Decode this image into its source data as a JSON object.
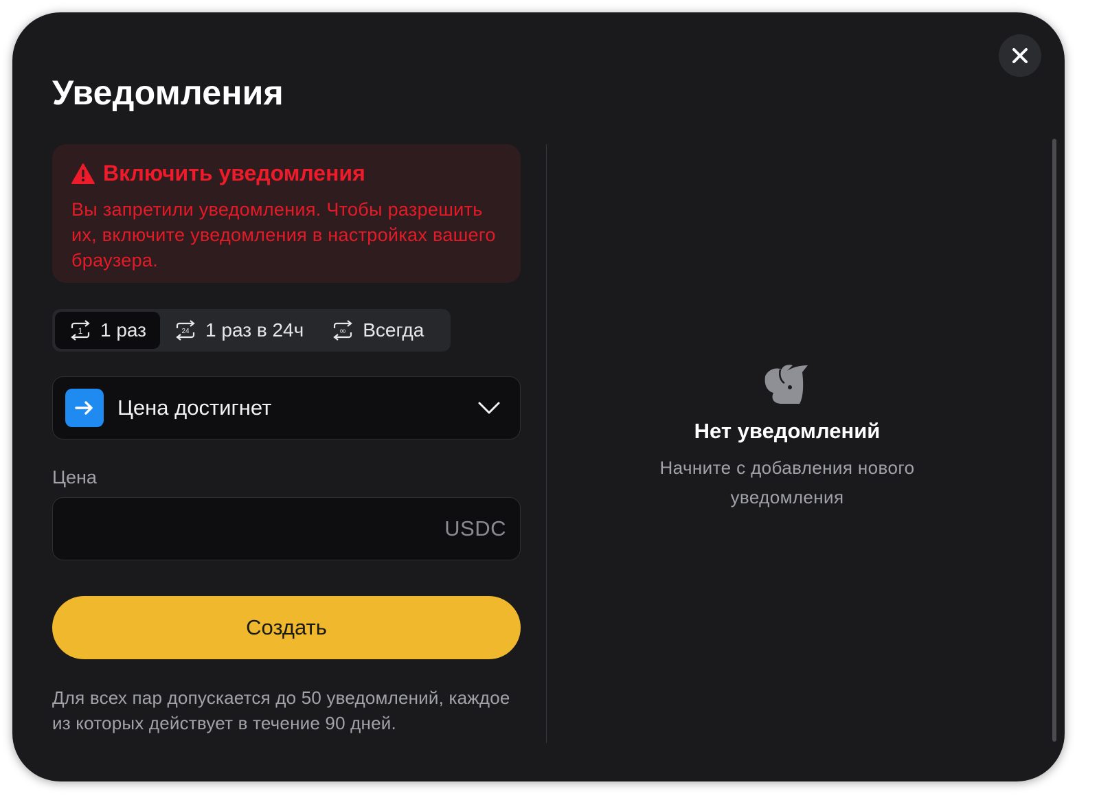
{
  "modal": {
    "title": "Уведомления",
    "close_icon": "close-icon"
  },
  "alert": {
    "icon": "warning-triangle-icon",
    "title": "Включить уведомления",
    "text": "Вы запретили уведомления. Чтобы разрешить их, включите уведомления в настройках вашего браузера."
  },
  "frequency": {
    "selected": "1 раз",
    "options": [
      {
        "label": "1 раз",
        "icon": "repeat-once-icon"
      },
      {
        "label": "1 раз в 24ч",
        "icon": "repeat-24h-icon"
      },
      {
        "label": "Всегда",
        "icon": "repeat-always-icon"
      }
    ]
  },
  "condition": {
    "label": "Цена достигнет",
    "icon": "arrow-right-icon",
    "dropdown_icon": "chevron-down-icon"
  },
  "price": {
    "label": "Цена",
    "value": "",
    "unit": "USDC"
  },
  "create_button": "Создать",
  "footnote": "Для всех пар допускается до 50 уведомлений, каждое из которых действует в течение 90 дней.",
  "empty_state": {
    "icon": "bull-logo-icon",
    "title": "Нет уведомлений",
    "subtitle": "Начните с добавления нового уведомления"
  },
  "colors": {
    "background": "#1a1a1d",
    "accent": "#f0b92d",
    "danger": "#ee1b2a",
    "danger_bg": "#2f1c1f",
    "select_badge": "#1f8bf0"
  }
}
